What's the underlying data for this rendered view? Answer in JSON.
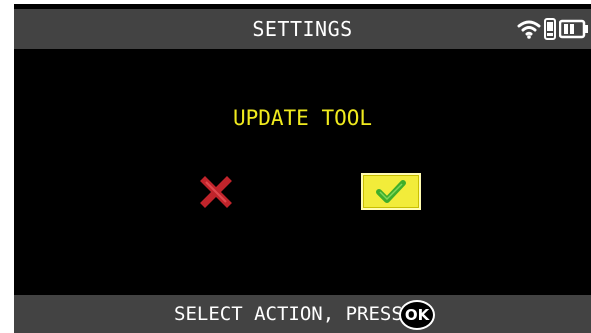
{
  "header": {
    "title": "SETTINGS",
    "status_icons": [
      "wifi-icon",
      "phone-link-icon",
      "battery-icon"
    ]
  },
  "dialog": {
    "title": "UPDATE TOOL",
    "cancel_icon": "cross-icon",
    "confirm_icon": "checkmark-icon",
    "selected": "confirm"
  },
  "footer": {
    "instruction": "SELECT ACTION, PRESS",
    "ok_label": "OK"
  },
  "colors": {
    "screen_bg": "#000000",
    "bar_bg": "#434343",
    "title_yellow": "#f0ea1e",
    "cancel_red": "#c0242b",
    "confirm_bg": "#f2ec3a",
    "check_green": "#3fae2a"
  }
}
